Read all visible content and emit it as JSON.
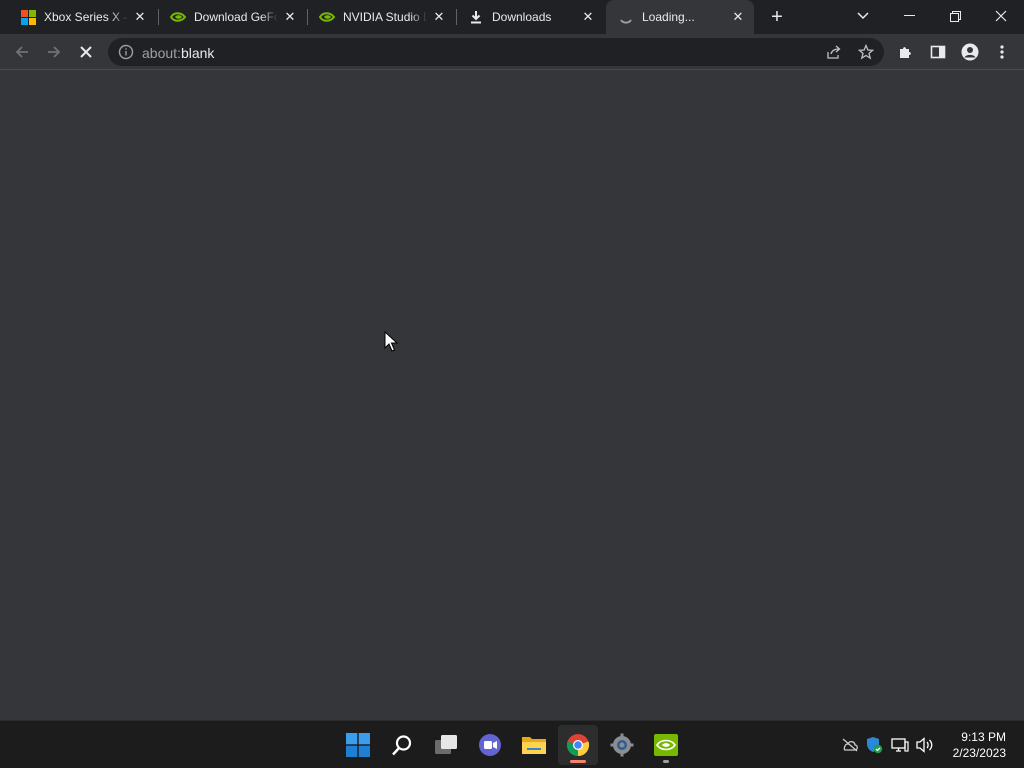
{
  "tabs": [
    {
      "title": "Xbox Series X – Microsoft",
      "favicon": "microsoft-logo-icon"
    },
    {
      "title": "Download GeForce Experience",
      "favicon": "nvidia-logo-icon"
    },
    {
      "title": "NVIDIA Studio Drivers",
      "favicon": "nvidia-logo-icon"
    },
    {
      "title": "Downloads",
      "favicon": "download-icon"
    },
    {
      "title": "Loading...",
      "favicon": "loading-spinner-icon",
      "active": true
    }
  ],
  "omnibox": {
    "scheme": "about:",
    "host": "blank"
  },
  "taskbar": {
    "apps": [
      "start-button",
      "search-button",
      "task-view-button",
      "teams-chat-button",
      "file-explorer-button",
      "chrome-button",
      "settings-button",
      "nvidia-geforce-button"
    ]
  },
  "clock": {
    "time": "9:13 PM",
    "date": "2/23/2023"
  },
  "colors": {
    "tabstrip": "#202124",
    "toolbar": "#35363a",
    "omnibox": "#202124",
    "nvidia_green": "#76b900",
    "taskbar": "#1c1c1c"
  }
}
